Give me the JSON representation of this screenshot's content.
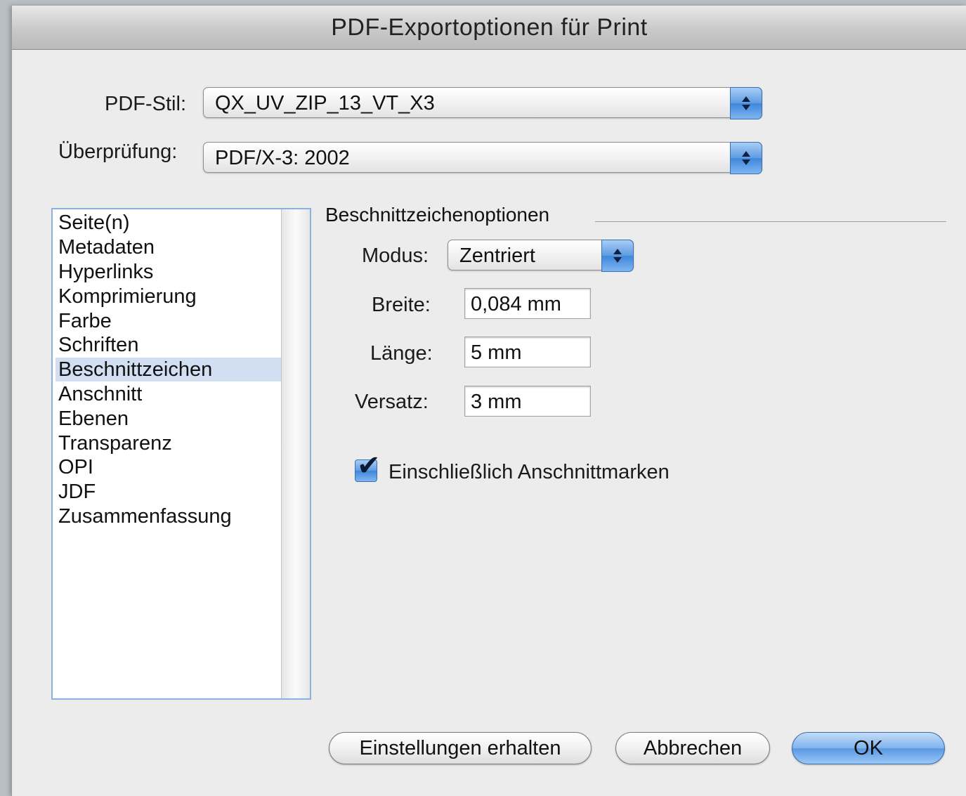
{
  "window": {
    "title": "PDF-Exportoptionen für Print"
  },
  "header": {
    "pdf_style_label": "PDF-Stil:",
    "pdf_style_value": "QX_UV_ZIP_13_VT_X3",
    "check_label": "Überprüfung:",
    "check_value": "PDF/X-3: 2002"
  },
  "sidebar": {
    "items": [
      {
        "label": "Seite(n)"
      },
      {
        "label": "Metadaten"
      },
      {
        "label": "Hyperlinks"
      },
      {
        "label": "Komprimierung"
      },
      {
        "label": "Farbe"
      },
      {
        "label": "Schriften"
      },
      {
        "label": "Beschnittzeichen"
      },
      {
        "label": "Anschnitt"
      },
      {
        "label": "Ebenen"
      },
      {
        "label": "Transparenz"
      },
      {
        "label": "OPI"
      },
      {
        "label": "JDF"
      },
      {
        "label": "Zusammenfassung"
      }
    ],
    "selected": "Beschnittzeichen"
  },
  "panel": {
    "section_title": "Beschnittzeichenoptionen",
    "mode_label": "Modus:",
    "mode_value": "Zentriert",
    "width_label": "Breite:",
    "width_value": "0,084 mm",
    "length_label": "Länge:",
    "length_value": "5 mm",
    "offset_label": "Versatz:",
    "offset_value": "3 mm",
    "include_bleed_label": "Einschließlich Anschnittmarken",
    "include_bleed_checked": true
  },
  "buttons": {
    "keep_settings": "Einstellungen erhalten",
    "cancel": "Abbrechen",
    "ok": "OK"
  }
}
